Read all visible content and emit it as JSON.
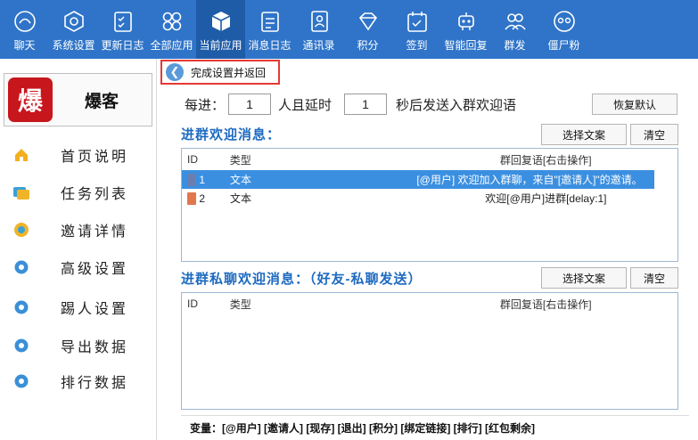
{
  "nav": {
    "items": [
      {
        "label": "聊天",
        "icon": "chat-icon"
      },
      {
        "label": "系统设置",
        "icon": "hexagon-settings-icon"
      },
      {
        "label": "更新日志",
        "icon": "checklist-icon"
      },
      {
        "label": "全部应用",
        "icon": "apps-grid-icon"
      },
      {
        "label": "当前应用",
        "icon": "cube-icon",
        "active": true
      },
      {
        "label": "消息日志",
        "icon": "message-log-icon"
      },
      {
        "label": "通讯录",
        "icon": "contacts-icon"
      },
      {
        "label": "积分",
        "icon": "diamond-icon"
      },
      {
        "label": "签到",
        "icon": "calendar-check-icon"
      },
      {
        "label": "智能回复",
        "icon": "robot-icon"
      },
      {
        "label": "群发",
        "icon": "group-icon"
      },
      {
        "label": "僵尸粉",
        "icon": "zombie-icon"
      }
    ]
  },
  "brand": {
    "logo_char": "爆",
    "name": "爆客",
    "logo_color": "#c8161d"
  },
  "sidebar": {
    "items": [
      {
        "label": "首页说明",
        "icon": "home-icon"
      },
      {
        "label": "任务列表",
        "icon": "task-list-icon"
      },
      {
        "label": "邀请详情",
        "icon": "invite-icon"
      },
      {
        "label": "高级设置",
        "icon": "gear-icon"
      },
      {
        "label": "踢人设置",
        "icon": "gear-icon"
      },
      {
        "label": "导出数据",
        "icon": "gear-icon"
      },
      {
        "label": "排行数据",
        "icon": "gear-icon"
      }
    ]
  },
  "main": {
    "back_label": "完成设置并返回",
    "delay": {
      "prefix": "每进：",
      "count": "1",
      "middle": "人且延时",
      "seconds": "1",
      "suffix": "秒后发送入群欢迎语",
      "reset_label": "恢复默认"
    },
    "welcome": {
      "title": "进群欢迎消息：",
      "select_label": "选择文案",
      "clear_label": "清空",
      "columns": [
        "ID",
        "类型",
        "群回复语[右击操作]"
      ],
      "rows": [
        {
          "id": "1",
          "type": "文本",
          "reply": "[@用户] 欢迎加入群聊，来自\"[邀请人]\"的邀请。",
          "selected": true
        },
        {
          "id": "2",
          "type": "文本",
          "reply": "欢迎[@用户]进群[delay:1]",
          "selected": false
        }
      ]
    },
    "private": {
      "title": "进群私聊欢迎消息：（好友-私聊发送）",
      "select_label": "选择文案",
      "clear_label": "清空",
      "columns": [
        "ID",
        "类型",
        "群回复语[右击操作]"
      ]
    },
    "variables": "变量：[@用户] [邀请人] [现存] [退出] [积分] [绑定链接] [排行] [红包剩余]"
  },
  "colors": {
    "nav_bg": "#2f74c8",
    "nav_active": "#1f5ca8",
    "accent_text": "#1e6ac0",
    "selection": "#3b8fe0",
    "back_border": "#e53935"
  }
}
